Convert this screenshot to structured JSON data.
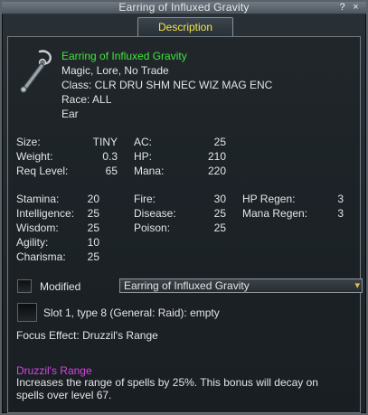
{
  "window": {
    "title": "Earring of Influxed Gravity",
    "help_glyph": "?",
    "close_glyph": "×"
  },
  "tab": {
    "label": "Description"
  },
  "item": {
    "name": "Earring of Influxed Gravity",
    "flags": "Magic, Lore, No Trade",
    "class": "Class: CLR DRU SHM NEC WIZ MAG ENC",
    "race": "Race: ALL",
    "slot": "Ear",
    "icon": "earring-icon"
  },
  "stats": {
    "size_label": "Size:",
    "size_value": "TINY",
    "weight_label": "Weight:",
    "weight_value": "0.3",
    "req_label": "Req Level:",
    "req_value": "65",
    "ac_label": "AC:",
    "ac_value": "25",
    "hp_label": "HP:",
    "hp_value": "210",
    "mana_label": "Mana:",
    "mana_value": "220"
  },
  "attributes": {
    "stamina_label": "Stamina:",
    "stamina_value": "20",
    "int_label": "Intelligence:",
    "int_value": "25",
    "wis_label": "Wisdom:",
    "wis_value": "25",
    "agi_label": "Agility:",
    "agi_value": "10",
    "cha_label": "Charisma:",
    "cha_value": "25",
    "fire_label": "Fire:",
    "fire_value": "30",
    "disease_label": "Disease:",
    "disease_value": "25",
    "poison_label": "Poison:",
    "poison_value": "25",
    "hpregen_label": "HP Regen:",
    "hpregen_value": "3",
    "manaregen_label": "Mana Regen:",
    "manaregen_value": "3"
  },
  "modified": {
    "label": "Modified",
    "dropdown_value": "Earring of Influxed Gravity",
    "dropdown_arrow": "▾"
  },
  "augment": {
    "slot_text": "Slot 1, type 8 (General: Raid): empty"
  },
  "focus": {
    "effect": "Focus Effect: Druzzil's Range",
    "spell_name": "Druzzil's Range",
    "desc_line1": "Increases the range of spells by 25%. This bonus will decay on",
    "desc_line2": "spells over level 67."
  },
  "colors": {
    "item_name": "#3ee63a",
    "spell_name": "#d646e0",
    "tab_label": "#f2e44a"
  }
}
